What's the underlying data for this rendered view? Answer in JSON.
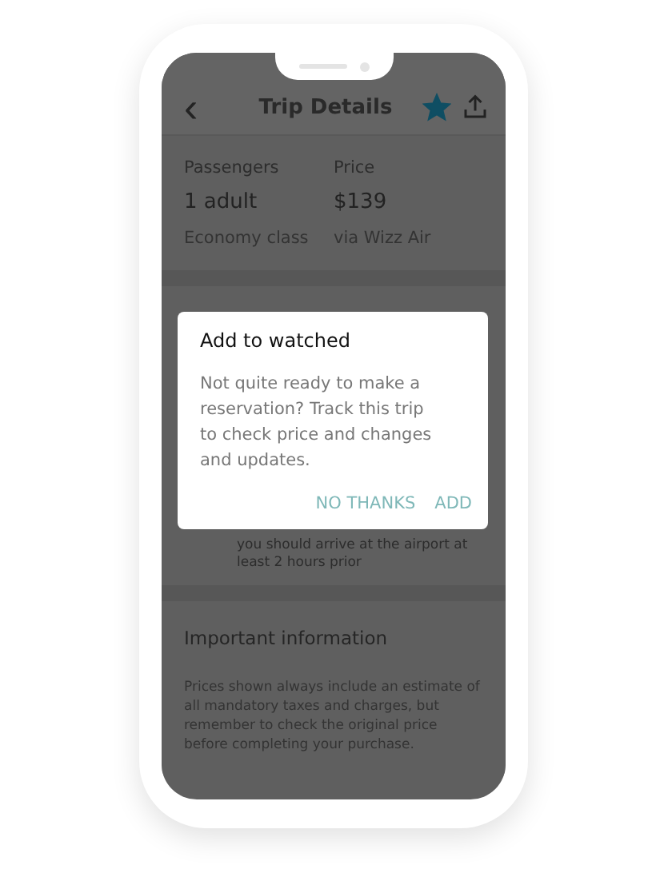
{
  "header": {
    "back": "‹",
    "title": "Trip Details",
    "starred": true
  },
  "summary": [
    {
      "label": "Passengers",
      "value": "1 adult",
      "note": "Economy class"
    },
    {
      "label": "Price",
      "value": "$139",
      "note": "via Wizz Air"
    }
  ],
  "notice": "you should arrive at the airport at least 2 hours prior",
  "important": {
    "title": "Important information",
    "text": "Prices shown always include an estimate of all mandatory taxes and charges, but remember to check the original price before completing your purchase."
  },
  "dialog": {
    "title": "Add to watched",
    "message": "Not quite ready to make a reservation? Track this trip to check price and changes and updates.",
    "buttons": [
      "NO THANKS",
      "ADD"
    ]
  }
}
